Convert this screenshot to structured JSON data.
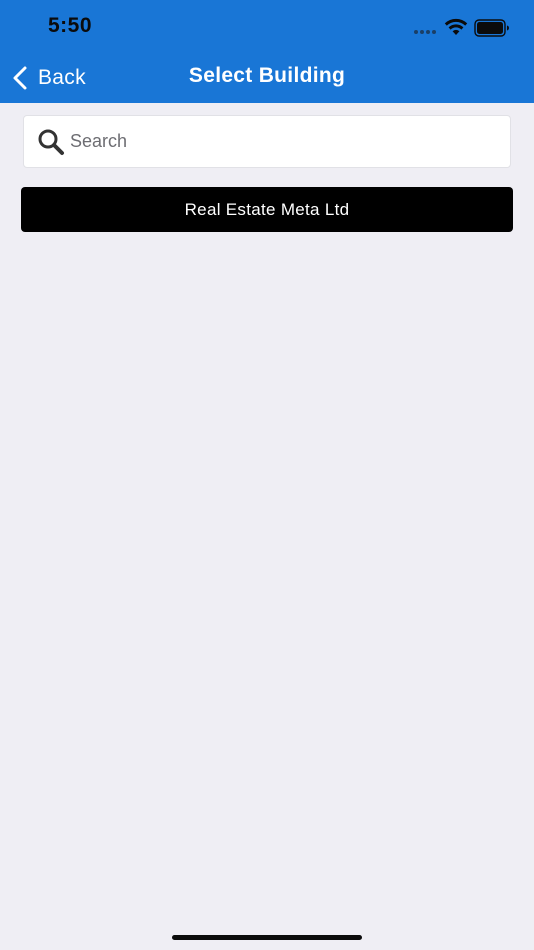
{
  "status_bar": {
    "time": "5:50",
    "icons": [
      "signal-dots-icon",
      "wifi-icon",
      "battery-icon"
    ]
  },
  "nav": {
    "back_label": "Back",
    "back_icon": "chevron-left-icon",
    "title": "Select Building"
  },
  "search": {
    "placeholder": "Search",
    "value": "",
    "icon": "search-icon"
  },
  "buildings": [
    {
      "label": "Real Estate Meta Ltd"
    }
  ],
  "colors": {
    "header_bg": "#1976d6",
    "page_bg": "#efeef4",
    "item_bg": "#000000",
    "item_text": "#ffffff"
  }
}
